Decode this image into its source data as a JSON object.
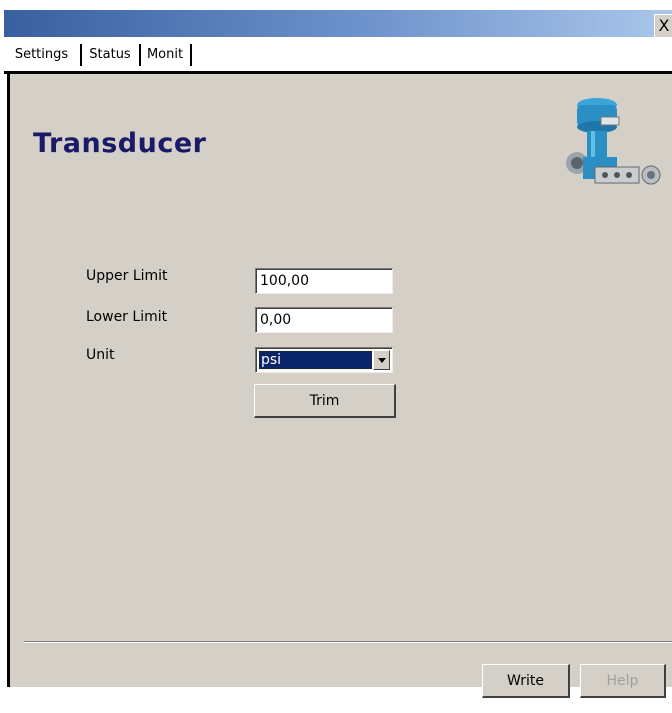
{
  "window": {
    "close_label": "X"
  },
  "tabs": [
    {
      "label": "Settings",
      "active": true
    },
    {
      "label": "Status",
      "active": false
    },
    {
      "label": "Monit",
      "active": false
    }
  ],
  "page": {
    "title": "Transducer"
  },
  "form": {
    "upper_limit": {
      "label": "Upper Limit",
      "value": "100,00"
    },
    "lower_limit": {
      "label": "Lower Limit",
      "value": "0,00"
    },
    "unit": {
      "label": "Unit",
      "value": "psi"
    },
    "trim_label": "Trim"
  },
  "footer": {
    "write_label": "Write",
    "help_label": "Help"
  },
  "colors": {
    "title": "#1a1a66",
    "panel": "#d4d0c8",
    "selection": "#0a246a"
  }
}
